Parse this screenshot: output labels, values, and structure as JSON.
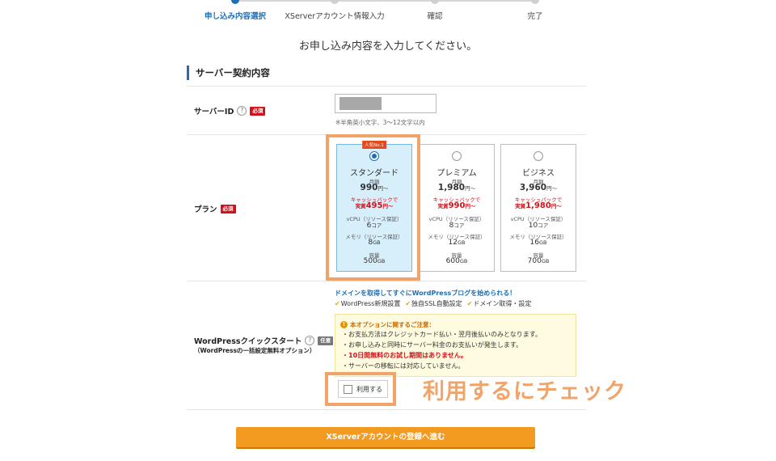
{
  "stepper": {
    "steps": [
      {
        "label": "申し込み内容選択",
        "active": true
      },
      {
        "label": "XServerアカウント情報入力",
        "active": false
      },
      {
        "label": "確認",
        "active": false
      },
      {
        "label": "完了",
        "active": false
      }
    ]
  },
  "intro_text": "お申し込み内容を入力してください。",
  "section_title": "サーバー契約内容",
  "server_id": {
    "label": "サーバーID",
    "help_icon": "?",
    "required_badge": "必須",
    "value": "",
    "note": "※半角英小文字、3〜12文字以内"
  },
  "plan": {
    "label": "プラン",
    "required_badge": "必須",
    "popular_badge": "人気No.1",
    "monthly_label": "月額",
    "price_suffix": "円〜",
    "cashback_label": "キャッシュバックで",
    "effective_prefix": "実質",
    "vcpu_label": "vCPU（リソース保証）",
    "memory_label": "メモリ（リソース保証）",
    "storage_label": "容量",
    "core_unit": "コア",
    "gb_unit": "GB",
    "options": [
      {
        "name": "スタンダード",
        "price": "990",
        "effective": "495",
        "vcpu": "6",
        "memory": "8",
        "storage": "500",
        "selected": true
      },
      {
        "name": "プレミアム",
        "price": "1,980",
        "effective": "990",
        "vcpu": "8",
        "memory": "12",
        "storage": "600",
        "selected": false
      },
      {
        "name": "ビジネス",
        "price": "3,960",
        "effective": "1,980",
        "vcpu": "10",
        "memory": "16",
        "storage": "700",
        "selected": false
      }
    ]
  },
  "wordpress": {
    "label": "WordPressクイックスタート",
    "sub_label": "（WordPressの一括設定無料オプション）",
    "optional_badge": "任意",
    "headline": "ドメインを取得してすぐにWordPressブログを始められる！",
    "features": [
      "WordPress新規設置",
      "独自SSL自動設定",
      "ドメイン取得・設定"
    ],
    "notice_title": "本オプションに関するご注意：",
    "notice_items": [
      {
        "text": "お支払方法はクレジットカード払い・翌月後払いのみとなります。",
        "emphasis": false
      },
      {
        "text": "お申し込みと同時にサーバー料金のお支払いが発生します。",
        "emphasis": false
      },
      {
        "text": "10日間無料のお試し期間はありません。",
        "emphasis": true
      },
      {
        "text": "サーバーの移転には対応していません。",
        "emphasis": false
      }
    ],
    "use_checkbox_label": "利用する",
    "use_checked": false
  },
  "annotation": "利用するにチェック",
  "submit_label": "XServerアカウントの登録へ進む",
  "colors": {
    "accent_blue": "#1f6fb5",
    "required_red": "#d0121b",
    "annotation_orange": "#f0a46a",
    "submit_orange": "#f39a20",
    "selected_plan_bg": "#d7eefb"
  }
}
